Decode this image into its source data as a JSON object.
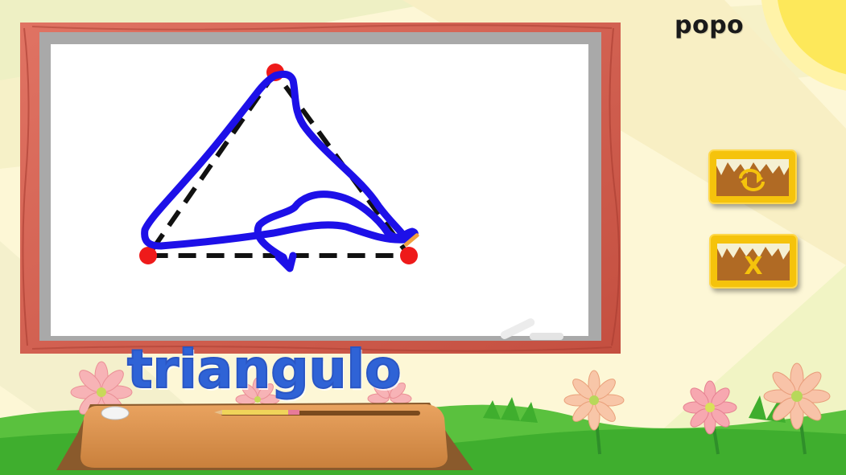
{
  "player": {
    "name": "popo"
  },
  "word": {
    "text": "triangulo"
  },
  "controls": {
    "repeat": {
      "icon": "repeat-arrows-icon"
    },
    "close": {
      "icon": "x-icon",
      "glyph": "X"
    }
  },
  "colors": {
    "trace": "#1d10e8",
    "vertex": "#ee1a1a",
    "guide": "#111111",
    "frame": "#cf5b4c",
    "button": "#f5c30c",
    "word": "#2f63d6"
  }
}
